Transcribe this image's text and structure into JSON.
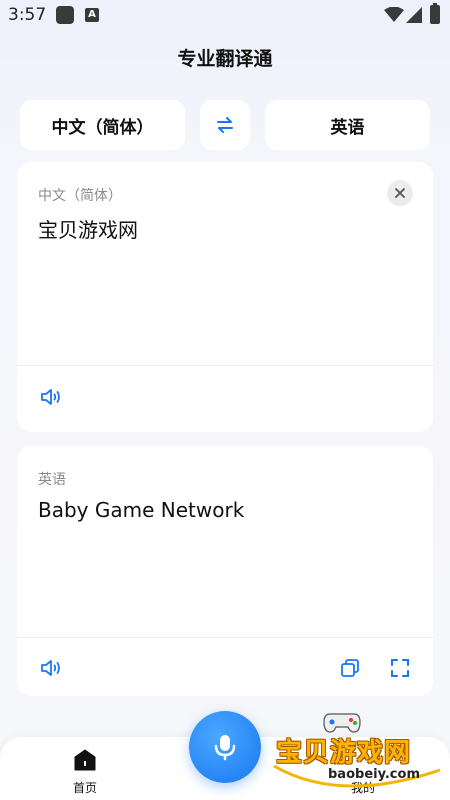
{
  "status": {
    "time": "3:57",
    "notif_icon": "A"
  },
  "app": {
    "title": "专业翻译通"
  },
  "lang_bar": {
    "source": "中文（简体）",
    "target": "英语"
  },
  "source_card": {
    "lang": "中文（简体）",
    "text": "宝贝游戏网"
  },
  "target_card": {
    "lang": "英语",
    "text": "Baby Game Network"
  },
  "nav": {
    "home": "首页",
    "mine": "我的"
  },
  "watermark": {
    "main": "宝贝游戏网",
    "url": "baobeiy.com"
  },
  "colors": {
    "accent": "#1877f2",
    "watermark": "#ffb400"
  }
}
